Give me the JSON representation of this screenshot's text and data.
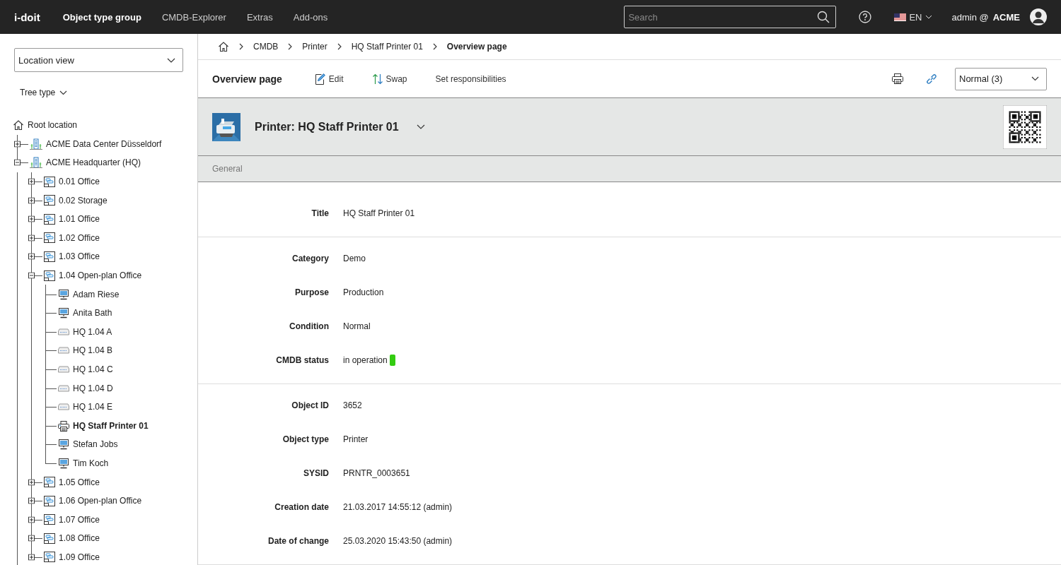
{
  "topbar": {
    "logo": "i-doit",
    "nav": [
      {
        "label": "Object type group",
        "selected": true
      },
      {
        "label": "CMDB-Explorer",
        "selected": false
      },
      {
        "label": "Extras",
        "selected": false
      },
      {
        "label": "Add-ons",
        "selected": false
      }
    ],
    "search": {
      "placeholder": "Search"
    },
    "language": "EN",
    "user": "admin @",
    "tenant": "ACME"
  },
  "sidebar": {
    "view": "Location view",
    "tree_type": "Tree type",
    "tree": [
      {
        "label": "Root location",
        "kind": "home",
        "selected": false,
        "children": [
          {
            "label": "ACME Data Center Düsseldorf",
            "kind": "building",
            "expanded": false,
            "selected": false
          },
          {
            "label": "ACME Headquarter (HQ)",
            "kind": "building",
            "expanded": true,
            "selected": false,
            "children": [
              {
                "label": "0.01 Office",
                "kind": "room",
                "expanded": false,
                "selected": false
              },
              {
                "label": "0.02 Storage",
                "kind": "room",
                "expanded": false,
                "selected": false
              },
              {
                "label": "1.01 Office",
                "kind": "room",
                "expanded": false,
                "selected": false
              },
              {
                "label": "1.02 Office",
                "kind": "room",
                "expanded": false,
                "selected": false
              },
              {
                "label": "1.03 Office",
                "kind": "room",
                "expanded": false,
                "selected": false
              },
              {
                "label": "1.04 Open-plan Office",
                "kind": "room",
                "expanded": true,
                "selected": false,
                "children": [
                  {
                    "label": "Adam Riese",
                    "kind": "workstation",
                    "selected": false
                  },
                  {
                    "label": "Anita Bath",
                    "kind": "workstation",
                    "selected": false
                  },
                  {
                    "label": "HQ 1.04 A",
                    "kind": "patch",
                    "selected": false
                  },
                  {
                    "label": "HQ 1.04 B",
                    "kind": "patch",
                    "selected": false
                  },
                  {
                    "label": "HQ 1.04 C",
                    "kind": "patch",
                    "selected": false
                  },
                  {
                    "label": "HQ 1.04 D",
                    "kind": "patch",
                    "selected": false
                  },
                  {
                    "label": "HQ 1.04 E",
                    "kind": "patch",
                    "selected": false
                  },
                  {
                    "label": "HQ Staff Printer 01",
                    "kind": "printer",
                    "selected": true
                  },
                  {
                    "label": "Stefan Jobs",
                    "kind": "workstation",
                    "selected": false
                  },
                  {
                    "label": "Tim Koch",
                    "kind": "workstation",
                    "selected": false
                  }
                ]
              },
              {
                "label": "1.05 Office",
                "kind": "room",
                "expanded": false,
                "selected": false
              },
              {
                "label": "1.06 Open-plan Office",
                "kind": "room",
                "expanded": false,
                "selected": false
              },
              {
                "label": "1.07 Office",
                "kind": "room",
                "expanded": false,
                "selected": false
              },
              {
                "label": "1.08 Office",
                "kind": "room",
                "expanded": false,
                "selected": false
              },
              {
                "label": "1.09 Office",
                "kind": "room",
                "expanded": false,
                "selected": false
              }
            ]
          }
        ]
      }
    ]
  },
  "breadcrumb": [
    "CMDB",
    "Printer",
    "HQ Staff Printer 01",
    "Overview page"
  ],
  "toolbar": {
    "title": "Overview page",
    "actions": [
      {
        "label": "Edit",
        "kind": "edit"
      },
      {
        "label": "Swap",
        "kind": "swap"
      },
      {
        "label": "Set responsibilities",
        "kind": "plain"
      }
    ],
    "status_select": "Normal (3)"
  },
  "object": {
    "title": "Printer: HQ Staff Printer 01",
    "section": "General"
  },
  "field_groups": [
    [
      {
        "label": "Title",
        "value": "HQ Staff Printer 01"
      }
    ],
    [
      {
        "label": "Category",
        "value": "Demo"
      },
      {
        "label": "Purpose",
        "value": "Production"
      },
      {
        "label": "Condition",
        "value": "Normal"
      },
      {
        "label": "CMDB status",
        "value": "in operation",
        "color": "#33cc11"
      }
    ],
    [
      {
        "label": "Object ID",
        "value": "3652"
      },
      {
        "label": "Object type",
        "value": "Printer"
      },
      {
        "label": "SYSID",
        "value": "PRNTR_0003651"
      },
      {
        "label": "Creation date",
        "value": "21.03.2017 14:55:12 (admin)"
      },
      {
        "label": "Date of change",
        "value": "25.03.2020 15:43:50 (admin)"
      }
    ]
  ]
}
